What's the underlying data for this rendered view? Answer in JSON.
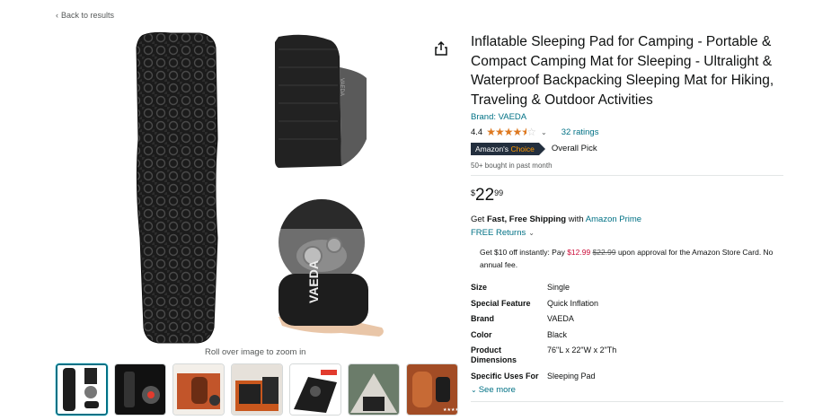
{
  "nav": {
    "back_label": "Back to results"
  },
  "gallery": {
    "zoom_hint": "Roll over image to zoom in",
    "thumb_count": 7,
    "main_logo_text": "VAEDA"
  },
  "product": {
    "title": "Inflatable Sleeping Pad for Camping - Portable & Compact Camping Mat for Sleeping - Ultralight & Waterproof Backpacking Sleeping Mat for Hiking, Traveling & Outdoor Activities",
    "brand_label": "Brand: VAEDA",
    "rating_value": "4.4",
    "rating_stars": 4.4,
    "ratings_count_label": "32 ratings",
    "badge_prefix": "Amazon's",
    "badge_suffix": "Choice",
    "overall_pick": "Overall Pick",
    "bought_text": "50+ bought in past month",
    "price_symbol": "$",
    "price_whole": "22",
    "price_fraction": "99"
  },
  "shipping": {
    "get": "Get",
    "fast_free": "Fast, Free Shipping",
    "with": "with",
    "prime_link": "Amazon Prime",
    "returns_label": "FREE Returns"
  },
  "promo": {
    "part1": "Get $10 off instantly: Pay",
    "new_price": "$12.99",
    "old_price": "$22.99",
    "part2": "upon approval for the Amazon Store Card. No annual fee."
  },
  "specs": [
    {
      "key": "Size",
      "value": "Single"
    },
    {
      "key": "Special Feature",
      "value": "Quick Inflation"
    },
    {
      "key": "Brand",
      "value": "VAEDA"
    },
    {
      "key": "Color",
      "value": "Black"
    },
    {
      "key": "Product Dimensions",
      "value": "76\"L x 22\"W x 2\"Th"
    },
    {
      "key": "Specific Uses For Product",
      "value": "Sleeping Pad"
    }
  ],
  "see_more_label": "See more",
  "colors": {
    "link": "#007185",
    "star": "#de7921",
    "badge": "#232f3e",
    "accent_orange": "#ff9900",
    "price_red": "#cc0c39"
  }
}
